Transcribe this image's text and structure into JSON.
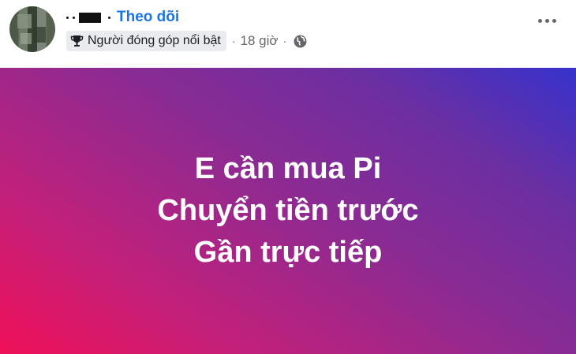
{
  "header": {
    "follow_label": "Theo dõi",
    "badge_label": "Người đóng góp nổi bật",
    "separator": "·",
    "time": "18 giờ",
    "badge_icon": "trophy-icon",
    "privacy_icon": "globe-icon",
    "more_icon": "more-options-icon"
  },
  "post": {
    "lines": [
      "E cần mua Pi",
      "Chuyển tiền trước",
      "Gần trực tiếp"
    ],
    "text_color": "#ffffff",
    "gradient_colors": [
      "#f01058",
      "#8a2b93",
      "#3632cc"
    ]
  },
  "colors": {
    "accent": "#1b74e4",
    "meta_text": "#65676b",
    "badge_bg": "#e9ebee"
  }
}
